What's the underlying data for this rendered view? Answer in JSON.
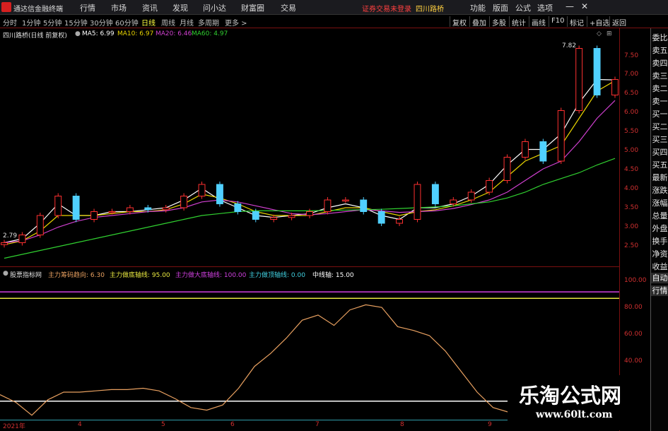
{
  "app_name": "通达信金融终端",
  "menu": [
    "行情",
    "市场",
    "资讯",
    "发现",
    "问小达",
    "财富圈",
    "交易"
  ],
  "menu_right": [
    "功能",
    "版面",
    "公式",
    "选项"
  ],
  "notice": "证券交易未登录",
  "notice_stock": "四川路桥",
  "periods": [
    "分时",
    "1分钟",
    "5分钟",
    "15分钟",
    "30分钟",
    "60分钟",
    "日线",
    "周线",
    "月线",
    "多周期",
    "更多 >"
  ],
  "active_period": "日线",
  "toolbar_right": [
    "复权",
    "叠加",
    "多股",
    "统计",
    "画线",
    "F10",
    "标记",
    "+自选",
    "返回"
  ],
  "info": {
    "title": "四川路桥(日线 前复权)",
    "ma5": "MA5: 6.99",
    "ma10": "MA10: 6.97",
    "ma20": "MA20: 6.46",
    "ma60": "MA60: 4.97"
  },
  "colors": {
    "ma5": "#ffffff",
    "ma10": "#e8d400",
    "ma20": "#d040d0",
    "ma60": "#30d030",
    "up": "#ff3030",
    "down": "#50d0ff",
    "axis": "#d03030"
  },
  "price_labels": [
    "7.50",
    "7.00",
    "6.50",
    "6.00",
    "5.50",
    "5.00",
    "4.50",
    "4.00",
    "3.50",
    "3.00",
    "2.50"
  ],
  "high_marker": "7.82",
  "low_marker": "2.79",
  "indicator": {
    "name": "股票指标网",
    "l1": "主力筹码趋向: 6.30",
    "l2": "主力做底轴线: 95.00",
    "l3": "主力做大底轴线: 100.00",
    "l4": "主力做顶轴线: 0.00",
    "l5": "中线轴: 15.00"
  },
  "ind_labels": [
    "100.00",
    "80.00",
    "60.00",
    "40.00"
  ],
  "dates": [
    "2021年",
    "4",
    "5",
    "6",
    "7",
    "8",
    "9"
  ],
  "side_panel": [
    "委比",
    "卖五",
    "卖四",
    "卖三",
    "卖二",
    "卖一",
    "买一",
    "买二",
    "买三",
    "买四",
    "买五",
    "最新",
    "涨跌",
    "涨幅",
    "总量",
    "外盘",
    "换手",
    "净资",
    "收益",
    "自动",
    "行情"
  ],
  "watermark": {
    "title": "乐淘公式网",
    "url": "www.60lt.com"
  },
  "chart_data": {
    "type": "line",
    "title": "四川路桥(日线 前复权)",
    "x": [
      "2021年",
      "4",
      "5",
      "6",
      "7",
      "8",
      "9"
    ],
    "ylim": [
      2.3,
      7.9
    ],
    "series": [
      {
        "name": "MA5",
        "values": [
          2.8,
          2.9,
          3.3,
          3.8,
          3.5,
          3.5,
          3.6,
          3.6,
          3.65,
          3.7,
          3.9,
          4.2,
          3.9,
          3.7,
          3.5,
          3.45,
          3.5,
          3.55,
          3.7,
          3.8,
          3.7,
          3.5,
          3.4,
          3.7,
          3.7,
          3.8,
          4.0,
          4.3,
          4.8,
          5.2,
          5.2,
          5.6,
          6.4,
          7.0,
          6.99
        ]
      },
      {
        "name": "MA10",
        "values": [
          2.75,
          2.85,
          3.1,
          3.5,
          3.5,
          3.5,
          3.55,
          3.6,
          3.6,
          3.65,
          3.8,
          4.05,
          3.95,
          3.8,
          3.6,
          3.5,
          3.5,
          3.5,
          3.6,
          3.7,
          3.7,
          3.6,
          3.5,
          3.6,
          3.65,
          3.75,
          3.9,
          4.1,
          4.5,
          4.9,
          5.1,
          5.3,
          6.0,
          6.7,
          6.97
        ]
      },
      {
        "name": "MA20",
        "values": [
          2.8,
          2.85,
          3.0,
          3.2,
          3.35,
          3.45,
          3.5,
          3.55,
          3.6,
          3.62,
          3.7,
          3.85,
          3.9,
          3.85,
          3.75,
          3.65,
          3.55,
          3.52,
          3.55,
          3.6,
          3.65,
          3.62,
          3.58,
          3.6,
          3.62,
          3.68,
          3.78,
          3.9,
          4.1,
          4.4,
          4.7,
          4.9,
          5.4,
          6.0,
          6.46
        ]
      },
      {
        "name": "MA60",
        "values": [
          2.4,
          2.5,
          2.6,
          2.7,
          2.8,
          2.9,
          3.0,
          3.1,
          3.2,
          3.3,
          3.4,
          3.5,
          3.55,
          3.6,
          3.62,
          3.62,
          3.62,
          3.62,
          3.63,
          3.64,
          3.65,
          3.66,
          3.68,
          3.7,
          3.72,
          3.75,
          3.8,
          3.85,
          3.95,
          4.1,
          4.3,
          4.45,
          4.6,
          4.8,
          4.97
        ]
      }
    ],
    "candles_close": [
      2.8,
      3.0,
      3.5,
      4.0,
      3.4,
      3.6,
      3.6,
      3.7,
      3.65,
      3.7,
      4.0,
      4.3,
      3.8,
      3.6,
      3.4,
      3.45,
      3.5,
      3.6,
      3.9,
      3.9,
      3.6,
      3.3,
      3.4,
      4.3,
      3.8,
      3.9,
      4.1,
      4.4,
      5.0,
      5.4,
      4.9,
      6.2,
      7.8,
      6.6,
      7.0
    ],
    "indicator": {
      "name": "股票指标网",
      "ylim": [
        0,
        110
      ],
      "hlines": [
        100,
        95,
        15,
        0
      ],
      "values": [
        20,
        14,
        4,
        16,
        22,
        22,
        23,
        24,
        24,
        25,
        23,
        17,
        10,
        8,
        12,
        25,
        42,
        52,
        64,
        78,
        82,
        74,
        86,
        90,
        88,
        73,
        70,
        66,
        54,
        38,
        22,
        10,
        6.3
      ]
    }
  }
}
